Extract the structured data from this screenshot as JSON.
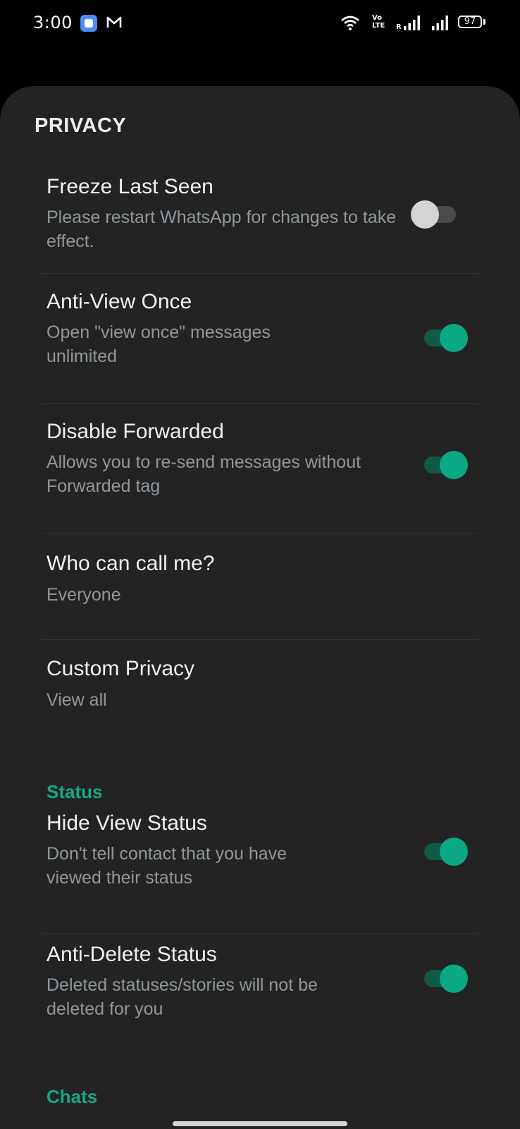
{
  "status_bar": {
    "time": "3:00",
    "network": "Vo LTE",
    "sim_label": "R",
    "battery": "97",
    "icons": [
      "app-notification-icon",
      "gmail-icon",
      "wifi-icon",
      "volte-icon",
      "signal-icon",
      "signal-icon",
      "battery-icon"
    ]
  },
  "section_title": "PRIVACY",
  "items": [
    {
      "title": "Freeze Last Seen",
      "subtitle": "Please restart WhatsApp for changes to take effect.",
      "toggle": "off"
    },
    {
      "title": "Anti-View Once",
      "subtitle": "Open \"view once\" messages unlimited",
      "toggle": "on"
    },
    {
      "title": "Disable Forwarded",
      "subtitle": "Allows you to re-send messages without Forwarded tag",
      "toggle": "on"
    },
    {
      "title": "Who can call me?",
      "subtitle": "Everyone"
    },
    {
      "title": "Custom Privacy",
      "subtitle": "View all"
    }
  ],
  "status_category": "Status",
  "status_items": [
    {
      "title": "Hide View Status",
      "subtitle": "Don't tell contact that you have viewed their status",
      "toggle": "on"
    },
    {
      "title": "Anti-Delete Status",
      "subtitle": "Deleted statuses/stories will not be deleted for you",
      "toggle": "on"
    }
  ],
  "chats_category": "Chats",
  "colors": {
    "accent": "#0aa883",
    "background": "#232323",
    "title_text": "#f1f1f1",
    "subtitle_text": "#8f979c"
  }
}
